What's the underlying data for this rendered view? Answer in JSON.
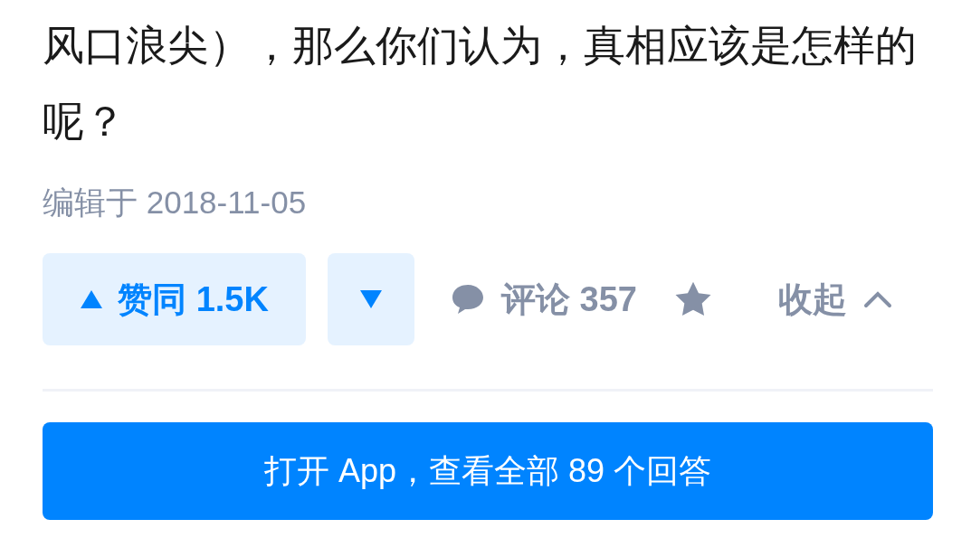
{
  "question_text": "风口浪尖），那么你们认为，真相应该是怎样的呢？",
  "edited": "编辑于 2018-11-05",
  "actions": {
    "upvote": "赞同 1.5K",
    "comments": "评论 357",
    "collapse": "收起"
  },
  "open_app_button": "打开 App，查看全部 89 个回答"
}
